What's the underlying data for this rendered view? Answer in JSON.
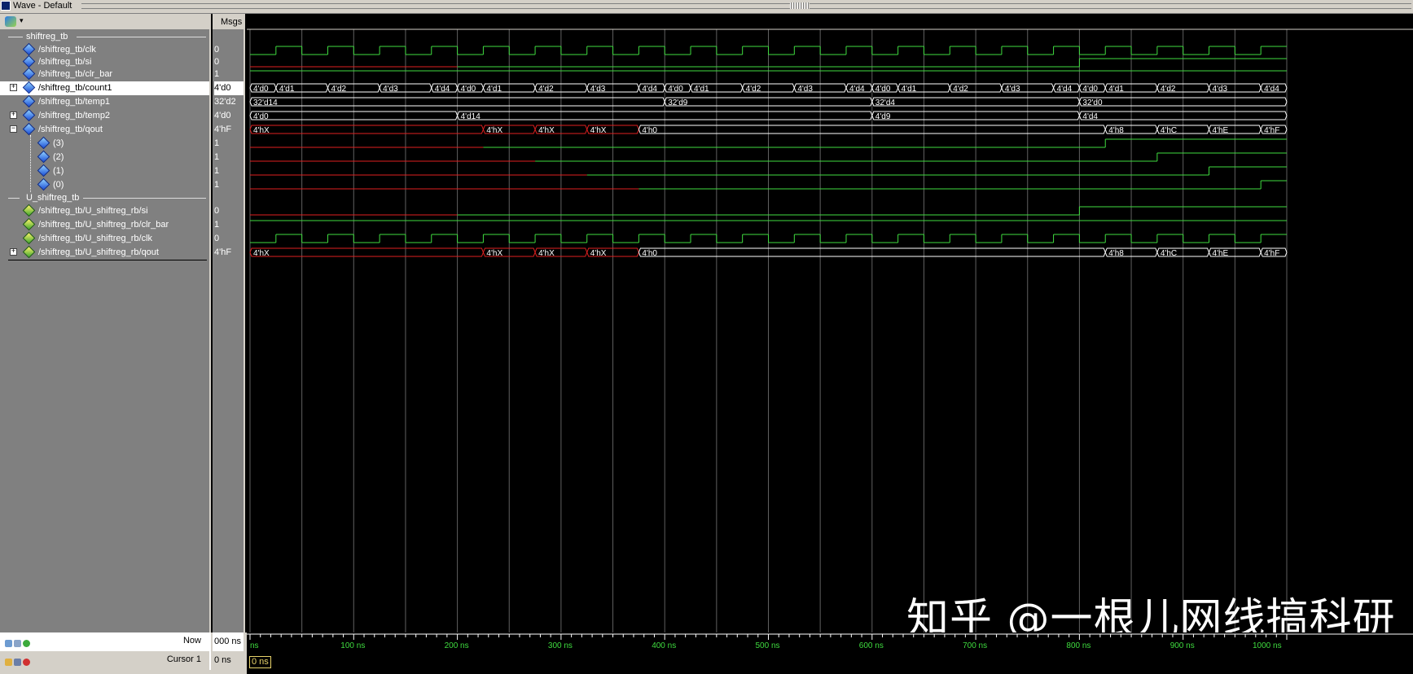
{
  "window": {
    "title": "Wave - Default"
  },
  "header": {
    "msgs_label": "Msgs"
  },
  "groups": [
    {
      "label": "shiftreg_tb"
    },
    {
      "label": "U_shiftreg_tb"
    }
  ],
  "signals": [
    {
      "name": "/shiftreg_tb/clk",
      "value": "0"
    },
    {
      "name": "/shiftreg_tb/si",
      "value": "0"
    },
    {
      "name": "/shiftreg_tb/clr_bar",
      "value": "1"
    },
    {
      "name": "/shiftreg_tb/count1",
      "value": "4'd0"
    },
    {
      "name": "/shiftreg_tb/temp1",
      "value": "32'd2"
    },
    {
      "name": "/shiftreg_tb/temp2",
      "value": "4'd0"
    },
    {
      "name": "/shiftreg_tb/qout",
      "value": "4'hF"
    },
    {
      "name": "(3)",
      "value": "1"
    },
    {
      "name": "(2)",
      "value": "1"
    },
    {
      "name": "(1)",
      "value": "1"
    },
    {
      "name": "(0)",
      "value": "1"
    },
    {
      "name": "/shiftreg_tb/U_shiftreg_rb/si",
      "value": "0"
    },
    {
      "name": "/shiftreg_tb/U_shiftreg_rb/clr_bar",
      "value": "1"
    },
    {
      "name": "/shiftreg_tb/U_shiftreg_rb/clk",
      "value": "0"
    },
    {
      "name": "/shiftreg_tb/U_shiftreg_rb/qout",
      "value": "4'hF"
    }
  ],
  "bus_labels": {
    "count1": [
      {
        "t": 0,
        "label": "4'd0"
      },
      {
        "t": 25,
        "label": "4'd1"
      },
      {
        "t": 75,
        "label": "4'd2"
      },
      {
        "t": 125,
        "label": "4'd3"
      },
      {
        "t": 175,
        "label": "4'd4"
      },
      {
        "t": 200,
        "label": "4'd0"
      },
      {
        "t": 225,
        "label": "4'd1"
      },
      {
        "t": 275,
        "label": "4'd2"
      },
      {
        "t": 325,
        "label": "4'd3"
      },
      {
        "t": 375,
        "label": "4'd4"
      },
      {
        "t": 400,
        "label": "4'd0"
      },
      {
        "t": 425,
        "label": "4'd1"
      },
      {
        "t": 475,
        "label": "4'd2"
      },
      {
        "t": 525,
        "label": "4'd3"
      },
      {
        "t": 575,
        "label": "4'd4"
      },
      {
        "t": 600,
        "label": "4'd0"
      },
      {
        "t": 625,
        "label": "4'd1"
      },
      {
        "t": 675,
        "label": "4'd2"
      },
      {
        "t": 725,
        "label": "4'd3"
      },
      {
        "t": 775,
        "label": "4'd4"
      },
      {
        "t": 800,
        "label": "4'd0"
      },
      {
        "t": 825,
        "label": "4'd1"
      },
      {
        "t": 875,
        "label": "4'd2"
      },
      {
        "t": 925,
        "label": "4'd3"
      },
      {
        "t": 975,
        "label": "4'd4"
      }
    ],
    "temp1": [
      {
        "t": 0,
        "label": "32'd14"
      },
      {
        "t": 400,
        "label": "32'd9"
      },
      {
        "t": 600,
        "label": "32'd4"
      },
      {
        "t": 800,
        "label": "32'd0"
      }
    ],
    "temp2": [
      {
        "t": 0,
        "label": "4'd0"
      },
      {
        "t": 200,
        "label": "4'd14"
      },
      {
        "t": 600,
        "label": "4'd9"
      },
      {
        "t": 800,
        "label": "4'd4"
      }
    ],
    "qout": [
      {
        "t": 0,
        "label": "4'hX",
        "x": true
      },
      {
        "t": 225,
        "label": "4'hX",
        "x": true
      },
      {
        "t": 275,
        "label": "4'hX",
        "x": true
      },
      {
        "t": 325,
        "label": "4'hX",
        "x": true
      },
      {
        "t": 375,
        "label": "4'h0"
      },
      {
        "t": 825,
        "label": "4'h8"
      },
      {
        "t": 875,
        "label": "4'hC"
      },
      {
        "t": 925,
        "label": "4'hE"
      },
      {
        "t": 975,
        "label": "4'hF"
      }
    ]
  },
  "timeline": {
    "units": "ns",
    "end": 1000,
    "ticks": [
      {
        "t": 0,
        "label": "ns"
      },
      {
        "t": 100,
        "label": "100 ns"
      },
      {
        "t": 200,
        "label": "200 ns"
      },
      {
        "t": 300,
        "label": "300 ns"
      },
      {
        "t": 400,
        "label": "400 ns"
      },
      {
        "t": 500,
        "label": "500 ns"
      },
      {
        "t": 600,
        "label": "600 ns"
      },
      {
        "t": 700,
        "label": "700 ns"
      },
      {
        "t": 800,
        "label": "800 ns"
      },
      {
        "t": 900,
        "label": "900 ns"
      },
      {
        "t": 1000,
        "label": "1000 ns"
      }
    ]
  },
  "footer": {
    "now_label": "Now",
    "now_value": "000 ns",
    "cursor_label": "Cursor 1",
    "cursor_value": "0 ns",
    "cursor_box": "0 ns"
  },
  "watermark": "知乎 @一根儿网线搞科研",
  "colors": {
    "wave": "#3fdc3f",
    "xstate": "#e02020",
    "bus": "#ffffff",
    "grid": "#606060",
    "timeline_text": "#3fdc3f"
  }
}
